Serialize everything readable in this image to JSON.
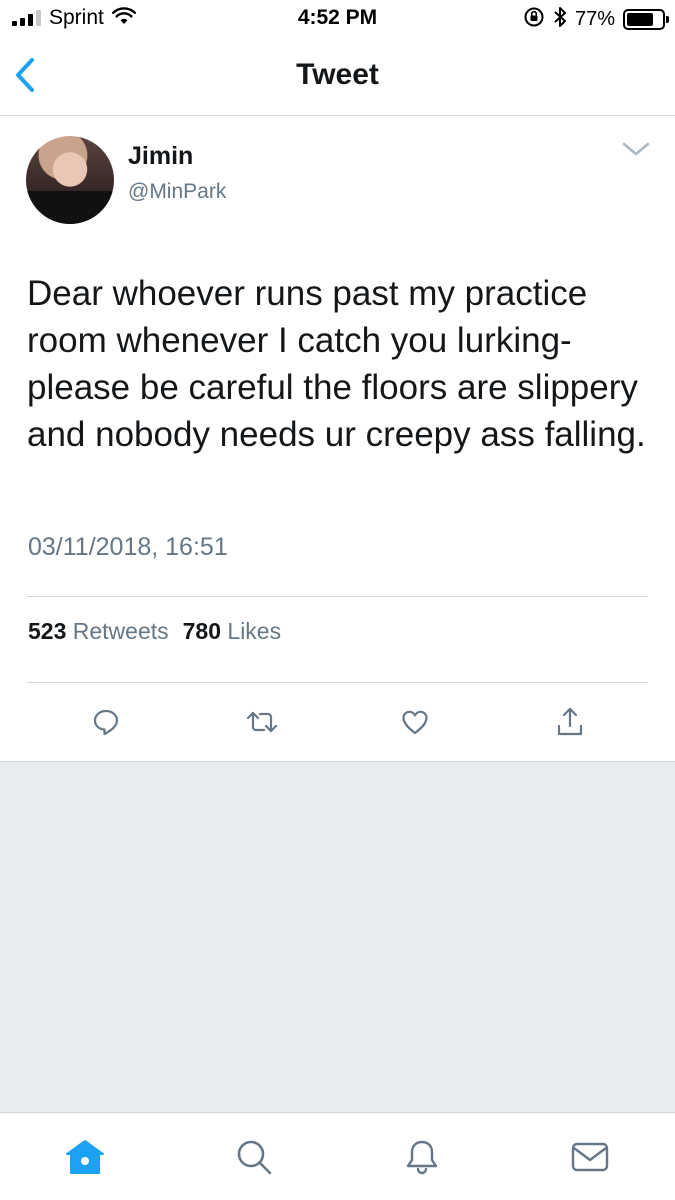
{
  "status_bar": {
    "carrier": "Sprint",
    "time": "4:52 PM",
    "battery_percent": "77%",
    "battery_level": 0.77
  },
  "nav": {
    "title": "Tweet",
    "back_icon": "chevron-left-icon"
  },
  "tweet": {
    "display_name": "Jimin",
    "username": "@MinPark",
    "text": "Dear whoever runs past my practice room whenever I catch you lurking- please be careful the floors are slippery and nobody needs ur creepy ass falling.",
    "timestamp": "03/11/2018, 16:51",
    "retweets_count": "523",
    "retweets_label": "Retweets",
    "likes_count": "780",
    "likes_label": "Likes"
  },
  "actions": [
    "reply-icon",
    "retweet-icon",
    "like-icon",
    "share-icon"
  ],
  "tabs": [
    "home-icon",
    "search-icon",
    "notifications-icon",
    "messages-icon"
  ],
  "colors": {
    "accent": "#1da1f2",
    "text": "#14171a",
    "secondary": "#657786",
    "divider": "#cfd5da",
    "background_gray": "#e6ecf0"
  }
}
